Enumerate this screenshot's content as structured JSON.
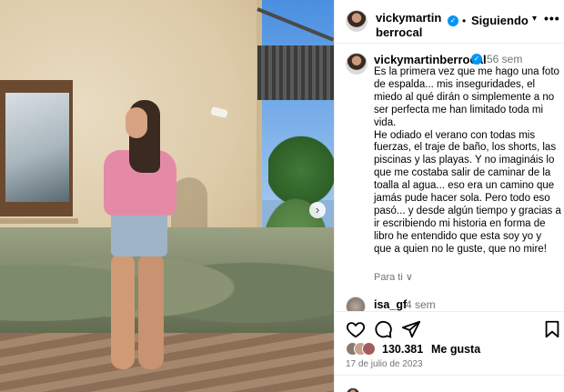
{
  "post": {
    "username": "vickymartinberrocal",
    "follow_label": "Siguiendo",
    "more_label": "•••",
    "separator": "•",
    "verified_icon": "verified-badge-icon",
    "caption": {
      "username": "vickymartinberrocal",
      "time": "56 sem",
      "text": "Es la primera vez que me hago una foto de espalda... mis inseguridades, el miedo al qué dirán o simplemente a no ser perfecta me han limitado toda mi vida.\nHe odiado el verano con todas mis fuerzas, el traje de baño, los shorts, las piscinas y las playas. Y no imagináis lo que me costaba salir de caminar de la toalla al agua... eso era un camino que jamás pude hacer sola. Pero todo eso pasó... y desde algún tiempo y gracias a ir escribiendo mi historia en forma de libro he entendido que esta soy yo y que a quien no le guste, que no mire!",
      "translate_label": "Para ti ∨"
    },
    "comment": {
      "username": "isa_gf",
      "time": "4 sem"
    },
    "actions": [
      "heart-icon",
      "comment-icon",
      "share-icon",
      "bookmark-icon"
    ],
    "likes_count": "130.381",
    "likes_label": "Me gusta",
    "date": "17 de julio de 2023",
    "carousel_next": "›",
    "colors": {
      "accent": "#0095f6",
      "muted": "#737373"
    }
  }
}
